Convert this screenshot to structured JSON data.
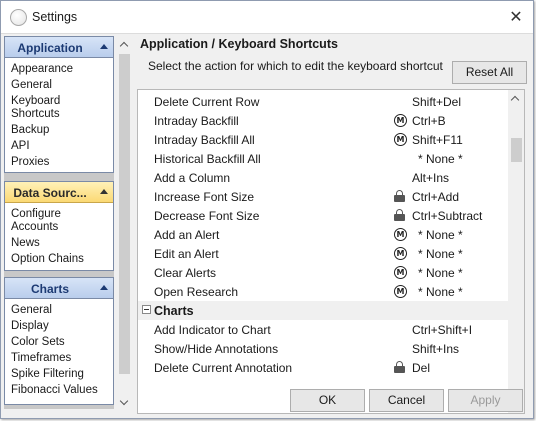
{
  "window": {
    "title": "Settings"
  },
  "sidebar": {
    "panels": [
      {
        "title": "Application",
        "items": [
          "Appearance",
          "General",
          "Keyboard Shortcuts",
          "Backup",
          "API",
          "Proxies"
        ]
      },
      {
        "title": "Data Sourc...",
        "items": [
          "Configure Accounts",
          "News",
          "Option Chains"
        ]
      },
      {
        "title": "Charts",
        "items": [
          "General",
          "Display",
          "Color Sets",
          "Timeframes",
          "Spike Filtering",
          "Fibonacci Values"
        ]
      }
    ]
  },
  "main": {
    "section_title": "Application / Keyboard Shortcuts",
    "instruction": "Select the action for which to edit the keyboard shortcut",
    "reset_label": "Reset All",
    "rows": [
      {
        "name": "Delete Current Row",
        "icon": "",
        "key": "Shift+Del"
      },
      {
        "name": "Intraday Backfill",
        "icon": "m-icon",
        "key": "Ctrl+B"
      },
      {
        "name": "Intraday Backfill All",
        "icon": "m-icon",
        "key": "Shift+F11"
      },
      {
        "name": "Historical Backfill All",
        "icon": "",
        "key": "* None *"
      },
      {
        "name": "Add a Column",
        "icon": "",
        "key": "Alt+Ins"
      },
      {
        "name": "Increase Font Size",
        "icon": "lock-icon",
        "key": "Ctrl+Add"
      },
      {
        "name": "Decrease Font Size",
        "icon": "lock-icon",
        "key": "Ctrl+Subtract"
      },
      {
        "name": "Add an Alert",
        "icon": "m-icon",
        "key": "* None *"
      },
      {
        "name": "Edit an Alert",
        "icon": "m-icon",
        "key": "* None *"
      },
      {
        "name": "Clear Alerts",
        "icon": "m-icon",
        "key": "* None *"
      },
      {
        "name": "Open Research",
        "icon": "m-icon",
        "key": "* None *"
      }
    ],
    "group": {
      "name": "Charts"
    },
    "group_rows": [
      {
        "name": "Add Indicator to Chart",
        "icon": "",
        "key": "Ctrl+Shift+I"
      },
      {
        "name": "Show/Hide Annotations",
        "icon": "",
        "key": "Shift+Ins"
      },
      {
        "name": "Delete Current Annotation",
        "icon": "lock-icon",
        "key": "Del"
      }
    ],
    "m_icon_glyph": "M"
  },
  "footer": {
    "ok_label": "OK",
    "cancel_label": "Cancel",
    "apply_label": "Apply"
  }
}
